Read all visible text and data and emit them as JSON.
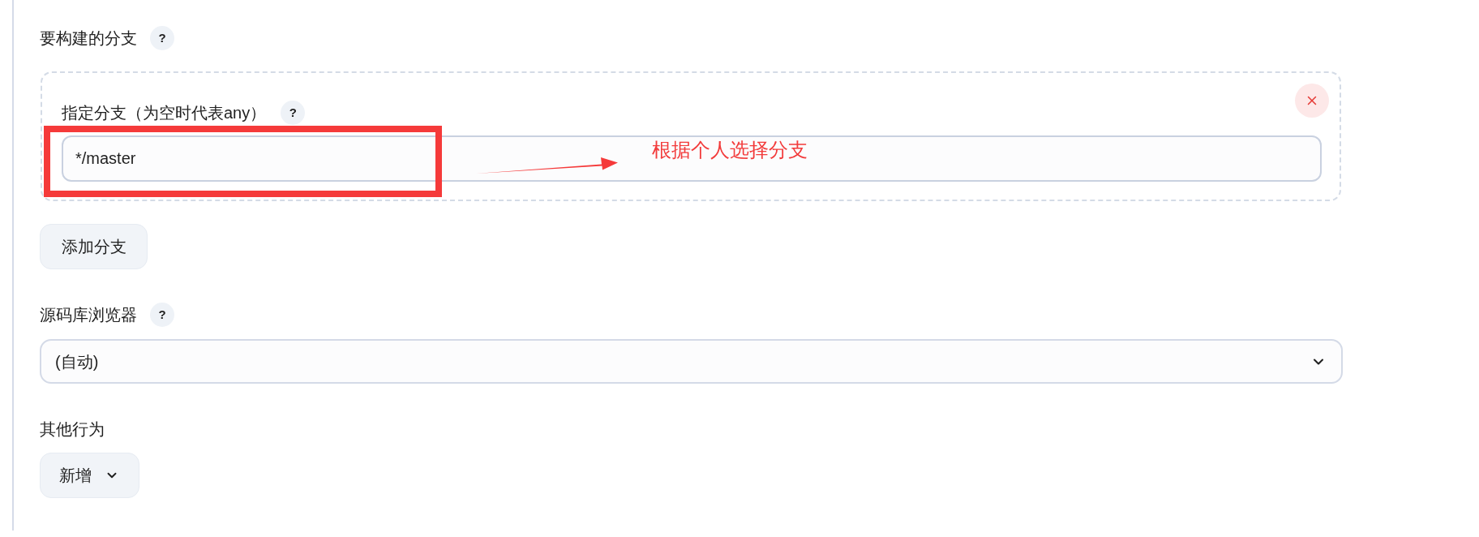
{
  "branches_to_build": {
    "label": "要构建的分支",
    "help": "?",
    "branches": [
      {
        "label": "指定分支（为空时代表any）",
        "help": "?",
        "value": "*/master"
      }
    ],
    "add_button": "添加分支"
  },
  "annotation": {
    "text": "根据个人选择分支"
  },
  "repository_browser": {
    "label": "源码库浏览器",
    "help": "?",
    "value": "(自动)"
  },
  "additional_behaviours": {
    "label": "其他行为",
    "add_button": "新增"
  }
}
